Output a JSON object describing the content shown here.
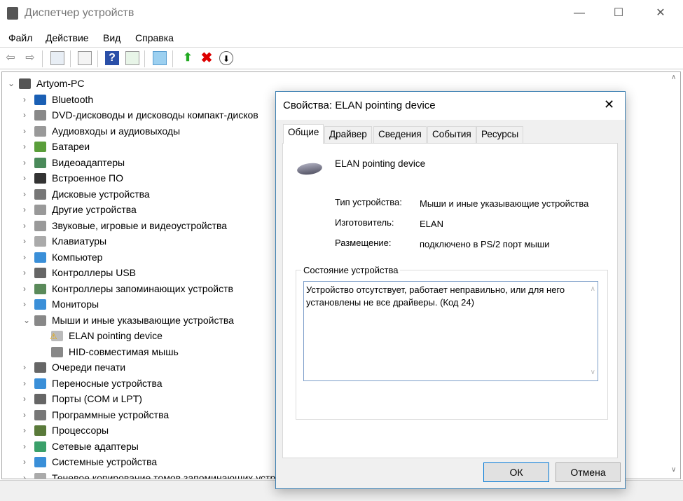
{
  "window": {
    "title": "Диспетчер устройств",
    "minimize": "—",
    "maximize": "☐",
    "close": "✕"
  },
  "menu": [
    "Файл",
    "Действие",
    "Вид",
    "Справка"
  ],
  "tree": {
    "root": "Artyom-PC",
    "items": [
      {
        "label": "Bluetooth",
        "color": "#1a5fb4"
      },
      {
        "label": "DVD-дисководы и дисководы компакт-дисков",
        "color": "#888"
      },
      {
        "label": "Аудиовходы и аудиовыходы",
        "color": "#999"
      },
      {
        "label": "Батареи",
        "color": "#5a9e3a"
      },
      {
        "label": "Видеоадаптеры",
        "color": "#4a8a5a"
      },
      {
        "label": "Встроенное ПО",
        "color": "#333"
      },
      {
        "label": "Дисковые устройства",
        "color": "#777"
      },
      {
        "label": "Другие устройства",
        "color": "#999"
      },
      {
        "label": "Звуковые, игровые и видеоустройства",
        "color": "#999"
      },
      {
        "label": "Клавиатуры",
        "color": "#aaa"
      },
      {
        "label": "Компьютер",
        "color": "#3a8fd8"
      },
      {
        "label": "Контроллеры USB",
        "color": "#666"
      },
      {
        "label": "Контроллеры запоминающих устройств",
        "color": "#5a8a5a"
      },
      {
        "label": "Мониторы",
        "color": "#3a8fd8"
      },
      {
        "label": "Мыши и иные указывающие устройства",
        "color": "#888",
        "expanded": true,
        "children": [
          {
            "label": "ELAN pointing device",
            "warning": true
          },
          {
            "label": "HID-совместимая мышь"
          }
        ]
      },
      {
        "label": "Очереди печати",
        "color": "#666"
      },
      {
        "label": "Переносные устройства",
        "color": "#3a8fd8"
      },
      {
        "label": "Порты (COM и LPT)",
        "color": "#666"
      },
      {
        "label": "Программные устройства",
        "color": "#777"
      },
      {
        "label": "Процессоры",
        "color": "#5a7a3a"
      },
      {
        "label": "Сетевые адаптеры",
        "color": "#3aa06a"
      },
      {
        "label": "Системные устройства",
        "color": "#3a8fd8"
      },
      {
        "label": "Теневое копирование томов запоминающих устройств",
        "color": "#aaa"
      }
    ]
  },
  "dialog": {
    "title": "Свойства: ELAN pointing device",
    "tabs": [
      "Общие",
      "Драйвер",
      "Сведения",
      "События",
      "Ресурсы"
    ],
    "device_name": "ELAN pointing device",
    "props": [
      {
        "label": "Тип устройства:",
        "value": "Мыши и иные указывающие устройства"
      },
      {
        "label": "Изготовитель:",
        "value": "ELAN"
      },
      {
        "label": "Размещение:",
        "value": "подключено в PS/2 порт мыши"
      }
    ],
    "status_group": "Состояние устройства",
    "status_text": "Устройство отсутствует, работает неправильно, или для него установлены не все драйверы. (Код 24)",
    "ok": "ОК",
    "cancel": "Отмена"
  }
}
